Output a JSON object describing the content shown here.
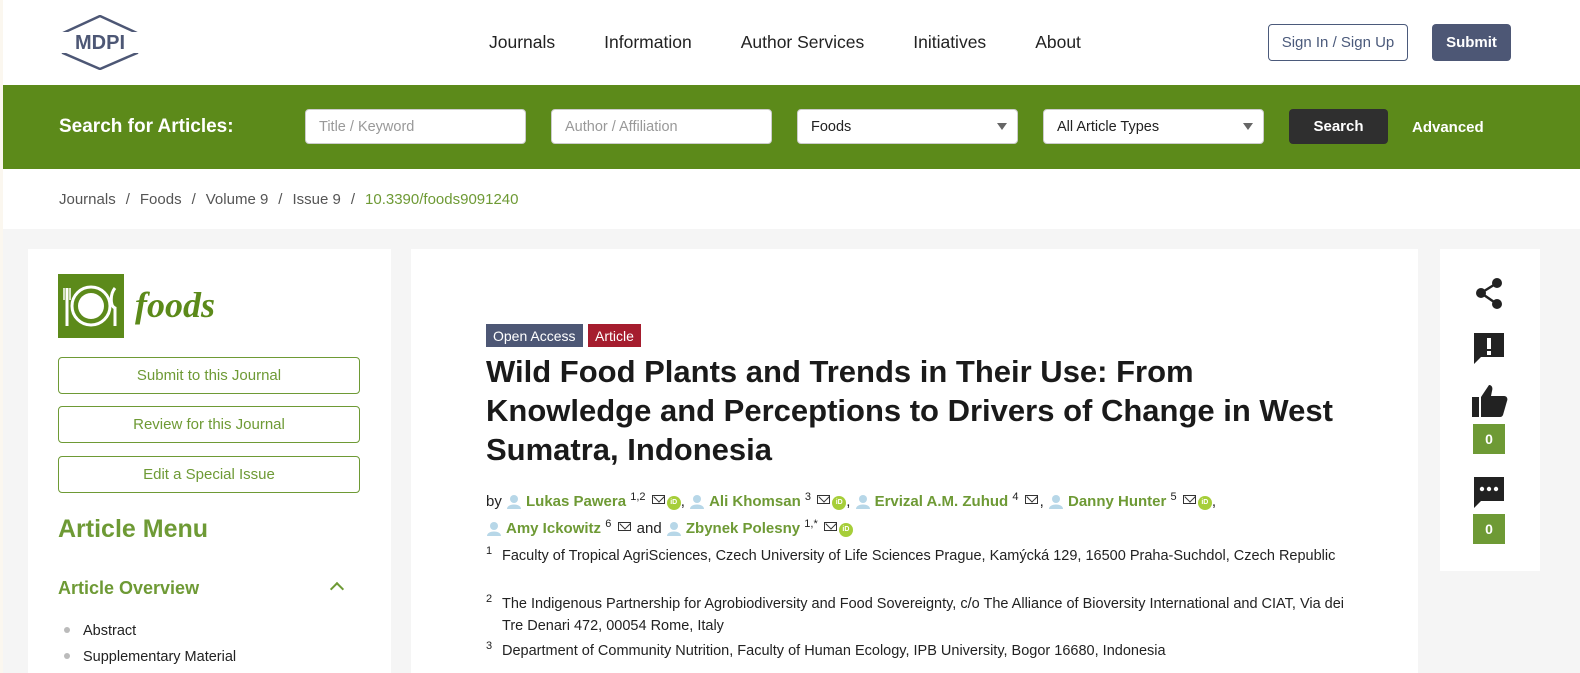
{
  "header": {
    "logo_text": "MDPI",
    "nav": [
      "Journals",
      "Information",
      "Author Services",
      "Initiatives",
      "About"
    ],
    "signin_label": "Sign In / Sign Up",
    "submit_label": "Submit"
  },
  "search": {
    "label": "Search for Articles:",
    "title_placeholder": "Title / Keyword",
    "author_placeholder": "Author / Affiliation",
    "journal_value": "Foods",
    "type_value": "All Article Types",
    "button_label": "Search",
    "advanced_label": "Advanced"
  },
  "breadcrumb": {
    "items": [
      "Journals",
      "Foods",
      "Volume 9",
      "Issue 9"
    ],
    "doi": "10.3390/foods9091240"
  },
  "sidebar": {
    "journal_name": "foods",
    "buttons": [
      "Submit to this Journal",
      "Review for this Journal",
      "Edit a Special Issue"
    ],
    "menu_title": "Article Menu",
    "overview_title": "Article Overview",
    "menu_items": [
      "Abstract",
      "Supplementary Material"
    ]
  },
  "article": {
    "badge_open_access": "Open Access",
    "badge_type": "Article",
    "title": "Wild Food Plants and Trends in Their Use: From Knowledge and Perceptions to Drivers of Change in West Sumatra, Indonesia",
    "by": "by",
    "and": "and",
    "authors": [
      {
        "name": "Lukas Pawera",
        "sup": "1,2"
      },
      {
        "name": "Ali Khomsan",
        "sup": "3"
      },
      {
        "name": "Ervizal A.M. Zuhud",
        "sup": "4"
      },
      {
        "name": "Danny Hunter",
        "sup": "5"
      },
      {
        "name": "Amy Ickowitz",
        "sup": "6"
      },
      {
        "name": "Zbynek Polesny",
        "sup": "1,*"
      }
    ],
    "affiliations": [
      {
        "num": "1",
        "text": "Faculty of Tropical AgriSciences, Czech University of Life Sciences Prague, Kamýcká 129, 16500 Praha-Suchdol, Czech Republic"
      },
      {
        "num": "2",
        "text": "The Indigenous Partnership for Agrobiodiversity and Food Sovereignty, c/o The Alliance of Bioversity International and CIAT, Via dei Tre Denari 472, 00054 Rome, Italy"
      },
      {
        "num": "3",
        "text": "Department of Community Nutrition, Faculty of Human Ecology, IPB University, Bogor 16680, Indonesia"
      }
    ]
  },
  "rightrail": {
    "icons": [
      "share-icon",
      "report-icon",
      "thumbs-up-icon",
      "comment-icon"
    ],
    "like_count": "0",
    "comment_count": "0"
  },
  "colors": {
    "brand_green": "#5c8a1a",
    "link_green": "#6e9a35",
    "mdpi_blue": "#4d5775",
    "article_red": "#a51d2e"
  }
}
